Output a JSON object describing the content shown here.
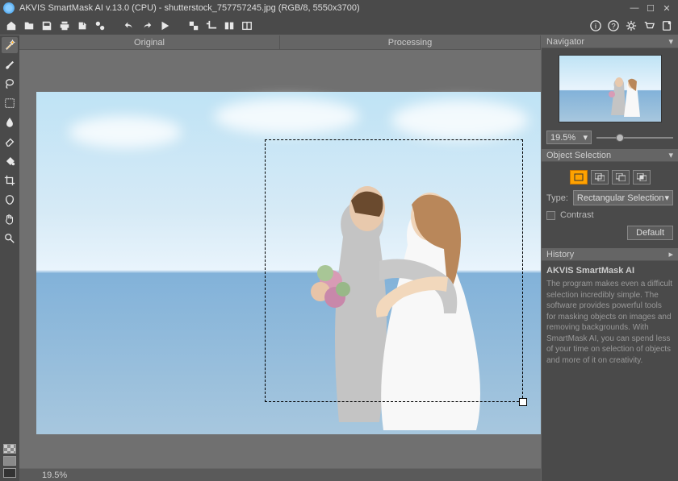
{
  "titlebar": {
    "app_name": "AKVIS SmartMask AI v.13.0 (CPU) - shutterstock_757757245.jpg (RGB/8, 5550x3700)"
  },
  "tabs": {
    "original": "Original",
    "processing": "Processing"
  },
  "toolbar": {
    "icons": [
      "home",
      "open",
      "save",
      "print",
      "undo",
      "redo",
      "history",
      "share",
      "batch",
      "presets",
      "layers",
      "info",
      "help",
      "settings",
      "buy",
      "about"
    ]
  },
  "navigator": {
    "title": "Navigator",
    "zoom": "19.5%"
  },
  "object_selection": {
    "title": "Object Selection",
    "type_label": "Type:",
    "type_value": "Rectangular Selection",
    "contrast_label": "Contrast",
    "default_btn": "Default"
  },
  "history": {
    "title": "History",
    "item": "AKVIS SmartMask AI",
    "desc": "The program makes even a difficult selection incredibly simple. The software provides powerful tools for masking objects on images and removing backgrounds. With SmartMask AI, you can spend less of your time on selection of objects and more of it on creativity."
  },
  "status": {
    "zoom": "19.5%"
  }
}
